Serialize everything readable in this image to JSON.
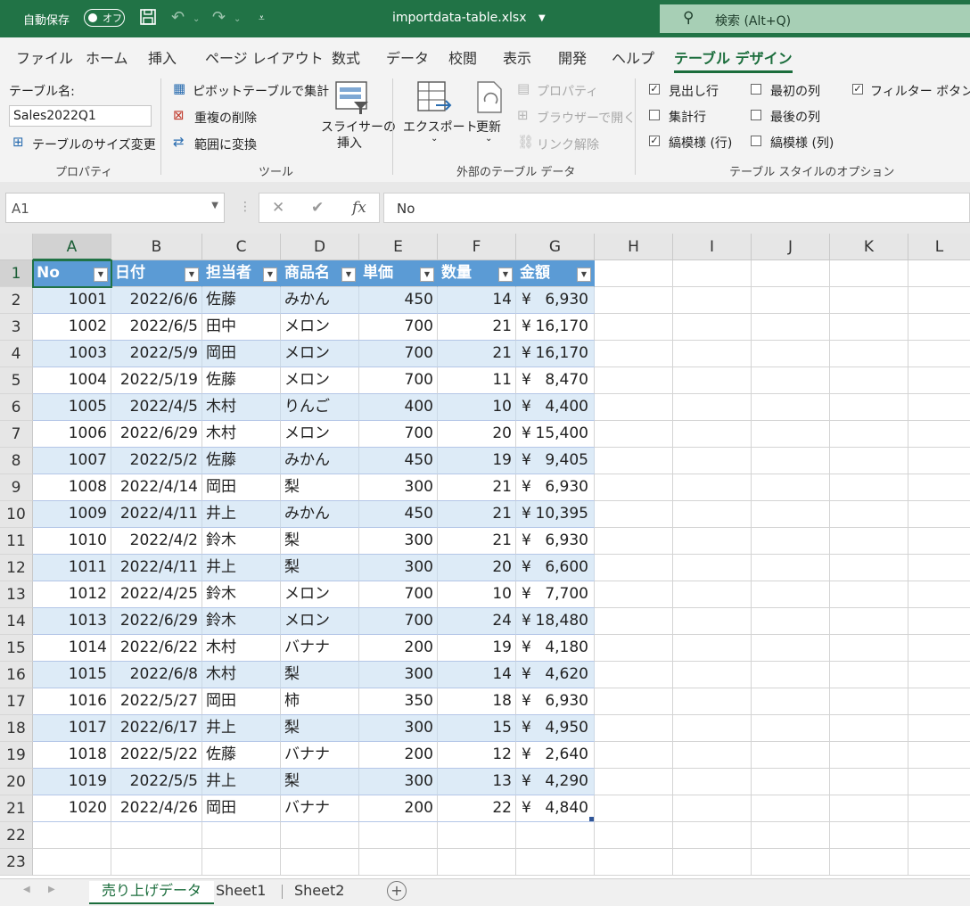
{
  "titlebar": {
    "autosave_label": "自動保存",
    "autosave_state": "オフ",
    "filename": "importdata-table.xlsx",
    "search_placeholder": "検索 (Alt+Q)"
  },
  "tabs": [
    "ファイル",
    "ホーム",
    "挿入",
    "ページ レイアウト",
    "数式",
    "データ",
    "校閲",
    "表示",
    "開発",
    "ヘルプ",
    "テーブル デザイン"
  ],
  "ribbon": {
    "properties": {
      "group_label": "プロパティ",
      "table_name_label": "テーブル名:",
      "table_name_value": "Sales2022Q1",
      "resize_label": "テーブルのサイズ変更"
    },
    "tools": {
      "group_label": "ツール",
      "pivot_label": "ピボットテーブルで集計",
      "remove_dup_label": "重複の削除",
      "convert_label": "範囲に変換",
      "slicer_label_1": "スライサーの",
      "slicer_label_2": "挿入"
    },
    "external": {
      "group_label": "外部のテーブル データ",
      "export_label": "エクスポート",
      "refresh_label": "更新",
      "properties_label": "プロパティ",
      "browser_label": "ブラウザーで開く",
      "unlink_label": "リンク解除"
    },
    "style_options": {
      "group_label": "テーブル スタイルのオプション",
      "header_row": "見出し行",
      "total_row": "集計行",
      "banded_rows": "縞模様 (行)",
      "first_column": "最初の列",
      "last_column": "最後の列",
      "banded_columns": "縞模様 (列)",
      "filter_button": "フィルター ボタン",
      "checkmark": "✓"
    }
  },
  "formula_bar": {
    "name_box": "A1",
    "cancel": "✕",
    "enter": "✔",
    "fx": "fx",
    "content": "No"
  },
  "columns": [
    "A",
    "B",
    "C",
    "D",
    "E",
    "F",
    "G",
    "H",
    "I",
    "J",
    "K",
    "L"
  ],
  "row_numbers": [
    "1",
    "2",
    "3",
    "4",
    "5",
    "6",
    "7",
    "8",
    "9",
    "10",
    "11",
    "12",
    "13",
    "14",
    "15",
    "16",
    "17",
    "18",
    "19",
    "20",
    "21",
    "22",
    "23"
  ],
  "table": {
    "headers": [
      "No",
      "日付",
      "担当者",
      "商品名",
      "単価",
      "数量",
      "金額"
    ],
    "currency_symbol": "¥",
    "rows": [
      [
        "1001",
        "2022/6/6",
        "佐藤",
        "みかん",
        "450",
        "14",
        "6,930"
      ],
      [
        "1002",
        "2022/6/5",
        "田中",
        "メロン",
        "700",
        "21",
        "16,170"
      ],
      [
        "1003",
        "2022/5/9",
        "岡田",
        "メロン",
        "700",
        "21",
        "16,170"
      ],
      [
        "1004",
        "2022/5/19",
        "佐藤",
        "メロン",
        "700",
        "11",
        "8,470"
      ],
      [
        "1005",
        "2022/4/5",
        "木村",
        "りんご",
        "400",
        "10",
        "4,400"
      ],
      [
        "1006",
        "2022/6/29",
        "木村",
        "メロン",
        "700",
        "20",
        "15,400"
      ],
      [
        "1007",
        "2022/5/2",
        "佐藤",
        "みかん",
        "450",
        "19",
        "9,405"
      ],
      [
        "1008",
        "2022/4/14",
        "岡田",
        "梨",
        "300",
        "21",
        "6,930"
      ],
      [
        "1009",
        "2022/4/11",
        "井上",
        "みかん",
        "450",
        "21",
        "10,395"
      ],
      [
        "1010",
        "2022/4/2",
        "鈴木",
        "梨",
        "300",
        "21",
        "6,930"
      ],
      [
        "1011",
        "2022/4/11",
        "井上",
        "梨",
        "300",
        "20",
        "6,600"
      ],
      [
        "1012",
        "2022/4/25",
        "鈴木",
        "メロン",
        "700",
        "10",
        "7,700"
      ],
      [
        "1013",
        "2022/6/29",
        "鈴木",
        "メロン",
        "700",
        "24",
        "18,480"
      ],
      [
        "1014",
        "2022/6/22",
        "木村",
        "バナナ",
        "200",
        "19",
        "4,180"
      ],
      [
        "1015",
        "2022/6/8",
        "木村",
        "梨",
        "300",
        "14",
        "4,620"
      ],
      [
        "1016",
        "2022/5/27",
        "岡田",
        "柿",
        "350",
        "18",
        "6,930"
      ],
      [
        "1017",
        "2022/6/17",
        "井上",
        "梨",
        "300",
        "15",
        "4,950"
      ],
      [
        "1018",
        "2022/5/22",
        "佐藤",
        "バナナ",
        "200",
        "12",
        "2,640"
      ],
      [
        "1019",
        "2022/5/5",
        "井上",
        "梨",
        "300",
        "13",
        "4,290"
      ],
      [
        "1020",
        "2022/4/26",
        "岡田",
        "バナナ",
        "200",
        "22",
        "4,840"
      ]
    ]
  },
  "sheets": [
    "売り上げデータ",
    "Sheet1",
    "Sheet2"
  ],
  "active_sheet": "売り上げデータ",
  "colors": {
    "excel_green": "#217346",
    "table_header": "#5b9bd5",
    "band": "#ddebf7"
  }
}
